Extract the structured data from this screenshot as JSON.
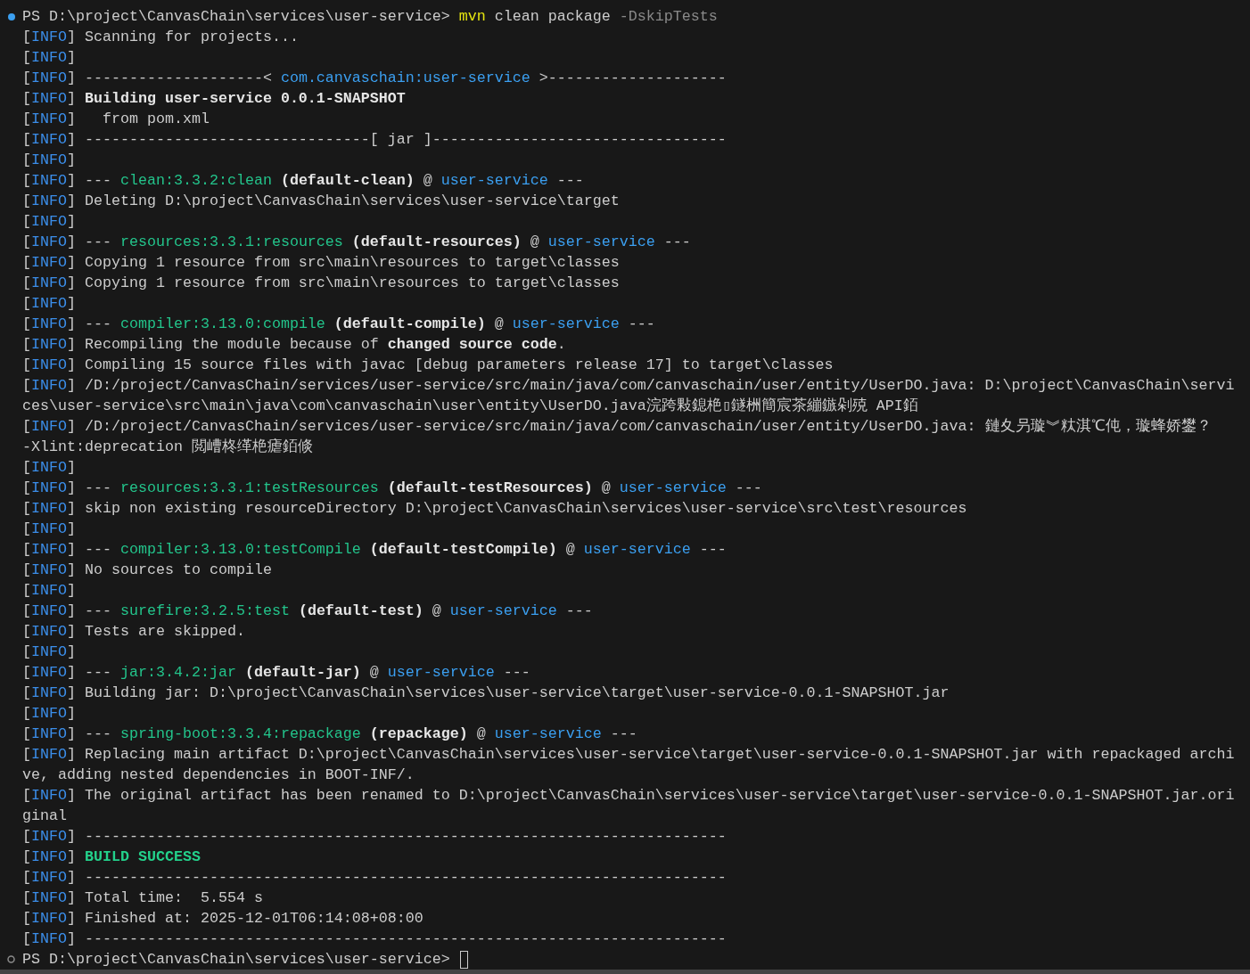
{
  "terminal": {
    "lines": [
      {
        "kind": "prompt",
        "completed": true,
        "segments": [
          {
            "kind": "plain",
            "text": "PS D:\\project\\CanvasChain\\services\\user-service> "
          },
          {
            "kind": "command",
            "text": "mvn"
          },
          {
            "kind": "plain",
            "text": " clean package "
          },
          {
            "kind": "dim",
            "text": "-DskipTests"
          }
        ]
      },
      {
        "kind": "info",
        "tag": "[INFO]",
        "segments": [
          {
            "kind": "plain",
            "text": "Scanning for projects..."
          }
        ]
      },
      {
        "kind": "info",
        "tag": "[INFO]"
      },
      {
        "kind": "info",
        "tag": "[INFO]",
        "segments": [
          {
            "kind": "plain",
            "text": "--------------------< "
          },
          {
            "kind": "project",
            "text": "com.canvaschain:user-service"
          },
          {
            "kind": "plain",
            "text": " >--------------------"
          }
        ]
      },
      {
        "kind": "info",
        "tag": "[INFO]",
        "segments": [
          {
            "kind": "bold",
            "text": "Building user-service 0.0.1-SNAPSHOT"
          }
        ]
      },
      {
        "kind": "info",
        "tag": "[INFO]",
        "segments": [
          {
            "kind": "plain",
            "text": "  from pom.xml"
          }
        ]
      },
      {
        "kind": "info",
        "tag": "[INFO]",
        "segments": [
          {
            "kind": "plain",
            "text": "--------------------------------[ jar ]---------------------------------"
          }
        ]
      },
      {
        "kind": "info",
        "tag": "[INFO]"
      },
      {
        "kind": "info",
        "tag": "[INFO]",
        "segments": [
          {
            "kind": "plain",
            "text": "--- "
          },
          {
            "kind": "plugin",
            "text": "clean:3.3.2:clean"
          },
          {
            "kind": "bold",
            "text": " (default-clean)"
          },
          {
            "kind": "plain",
            "text": " @ "
          },
          {
            "kind": "project",
            "text": "user-service"
          },
          {
            "kind": "plain",
            "text": " ---"
          }
        ]
      },
      {
        "kind": "info",
        "tag": "[INFO]",
        "segments": [
          {
            "kind": "plain",
            "text": "Deleting D:\\project\\CanvasChain\\services\\user-service\\target"
          }
        ]
      },
      {
        "kind": "info",
        "tag": "[INFO]"
      },
      {
        "kind": "info",
        "tag": "[INFO]",
        "segments": [
          {
            "kind": "plain",
            "text": "--- "
          },
          {
            "kind": "plugin",
            "text": "resources:3.3.1:resources"
          },
          {
            "kind": "bold",
            "text": " (default-resources)"
          },
          {
            "kind": "plain",
            "text": " @ "
          },
          {
            "kind": "project",
            "text": "user-service"
          },
          {
            "kind": "plain",
            "text": " ---"
          }
        ]
      },
      {
        "kind": "info",
        "tag": "[INFO]",
        "segments": [
          {
            "kind": "plain",
            "text": "Copying 1 resource from src\\main\\resources to target\\classes"
          }
        ]
      },
      {
        "kind": "info",
        "tag": "[INFO]",
        "segments": [
          {
            "kind": "plain",
            "text": "Copying 1 resource from src\\main\\resources to target\\classes"
          }
        ]
      },
      {
        "kind": "info",
        "tag": "[INFO]"
      },
      {
        "kind": "info",
        "tag": "[INFO]",
        "segments": [
          {
            "kind": "plain",
            "text": "--- "
          },
          {
            "kind": "plugin",
            "text": "compiler:3.13.0:compile"
          },
          {
            "kind": "bold",
            "text": " (default-compile)"
          },
          {
            "kind": "plain",
            "text": " @ "
          },
          {
            "kind": "project",
            "text": "user-service"
          },
          {
            "kind": "plain",
            "text": " ---"
          }
        ]
      },
      {
        "kind": "info",
        "tag": "[INFO]",
        "segments": [
          {
            "kind": "plain",
            "text": "Recompiling the module because of "
          },
          {
            "kind": "bold",
            "text": "changed source code"
          },
          {
            "kind": "plain",
            "text": "."
          }
        ]
      },
      {
        "kind": "info",
        "tag": "[INFO]",
        "segments": [
          {
            "kind": "plain",
            "text": "Compiling 15 source files with javac [debug parameters release 17] to target\\classes"
          }
        ]
      },
      {
        "kind": "info",
        "tag": "[INFO]",
        "segments": [
          {
            "kind": "plain",
            "text": "/D:/project/CanvasChain/services/user-service/src/main/java/com/canvaschain/user/entity/UserDO.java: D:\\project\\CanvasChain\\servi"
          }
        ]
      },
      {
        "kind": "continuation",
        "segments": [
          {
            "kind": "plain",
            "text": "ces\\user-service\\src\\main\\java\\com\\canvaschain\\user\\entity\\UserDO.java浣跨敤鎴栬▯鐩栦簡宸茶繃鏃剁殑 API銆"
          }
        ]
      },
      {
        "kind": "info",
        "tag": "[INFO]",
        "segments": [
          {
            "kind": "plain",
            "text": "/D:/project/CanvasChain/services/user-service/src/main/java/com/canvaschain/user/entity/UserDO.java: 鏈夊叧璇︾粏淇℃伅，璇蜂娇鐢？"
          }
        ]
      },
      {
        "kind": "continuation",
        "segments": [
          {
            "kind": "plain",
            "text": "-Xlint:deprecation 閲嶆柊缂栬瘧銆倐"
          }
        ]
      },
      {
        "kind": "info",
        "tag": "[INFO]"
      },
      {
        "kind": "info",
        "tag": "[INFO]",
        "segments": [
          {
            "kind": "plain",
            "text": "--- "
          },
          {
            "kind": "plugin",
            "text": "resources:3.3.1:testResources"
          },
          {
            "kind": "bold",
            "text": " (default-testResources)"
          },
          {
            "kind": "plain",
            "text": " @ "
          },
          {
            "kind": "project",
            "text": "user-service"
          },
          {
            "kind": "plain",
            "text": " ---"
          }
        ]
      },
      {
        "kind": "info",
        "tag": "[INFO]",
        "segments": [
          {
            "kind": "plain",
            "text": "skip non existing resourceDirectory D:\\project\\CanvasChain\\services\\user-service\\src\\test\\resources"
          }
        ]
      },
      {
        "kind": "info",
        "tag": "[INFO]"
      },
      {
        "kind": "info",
        "tag": "[INFO]",
        "segments": [
          {
            "kind": "plain",
            "text": "--- "
          },
          {
            "kind": "plugin",
            "text": "compiler:3.13.0:testCompile"
          },
          {
            "kind": "bold",
            "text": " (default-testCompile)"
          },
          {
            "kind": "plain",
            "text": " @ "
          },
          {
            "kind": "project",
            "text": "user-service"
          },
          {
            "kind": "plain",
            "text": " ---"
          }
        ]
      },
      {
        "kind": "info",
        "tag": "[INFO]",
        "segments": [
          {
            "kind": "plain",
            "text": "No sources to compile"
          }
        ]
      },
      {
        "kind": "info",
        "tag": "[INFO]"
      },
      {
        "kind": "info",
        "tag": "[INFO]",
        "segments": [
          {
            "kind": "plain",
            "text": "--- "
          },
          {
            "kind": "plugin",
            "text": "surefire:3.2.5:test"
          },
          {
            "kind": "bold",
            "text": " (default-test)"
          },
          {
            "kind": "plain",
            "text": " @ "
          },
          {
            "kind": "project",
            "text": "user-service"
          },
          {
            "kind": "plain",
            "text": " ---"
          }
        ]
      },
      {
        "kind": "info",
        "tag": "[INFO]",
        "segments": [
          {
            "kind": "plain",
            "text": "Tests are skipped."
          }
        ]
      },
      {
        "kind": "info",
        "tag": "[INFO]"
      },
      {
        "kind": "info",
        "tag": "[INFO]",
        "segments": [
          {
            "kind": "plain",
            "text": "--- "
          },
          {
            "kind": "plugin",
            "text": "jar:3.4.2:jar"
          },
          {
            "kind": "bold",
            "text": " (default-jar)"
          },
          {
            "kind": "plain",
            "text": " @ "
          },
          {
            "kind": "project",
            "text": "user-service"
          },
          {
            "kind": "plain",
            "text": " ---"
          }
        ]
      },
      {
        "kind": "info",
        "tag": "[INFO]",
        "segments": [
          {
            "kind": "plain",
            "text": "Building jar: D:\\project\\CanvasChain\\services\\user-service\\target\\user-service-0.0.1-SNAPSHOT.jar"
          }
        ]
      },
      {
        "kind": "info",
        "tag": "[INFO]"
      },
      {
        "kind": "info",
        "tag": "[INFO]",
        "segments": [
          {
            "kind": "plain",
            "text": "--- "
          },
          {
            "kind": "plugin",
            "text": "spring-boot:3.3.4:repackage"
          },
          {
            "kind": "bold",
            "text": " (repackage)"
          },
          {
            "kind": "plain",
            "text": " @ "
          },
          {
            "kind": "project",
            "text": "user-service"
          },
          {
            "kind": "plain",
            "text": " ---"
          }
        ]
      },
      {
        "kind": "info",
        "tag": "[INFO]",
        "segments": [
          {
            "kind": "plain",
            "text": "Replacing main artifact D:\\project\\CanvasChain\\services\\user-service\\target\\user-service-0.0.1-SNAPSHOT.jar with repackaged archi"
          }
        ]
      },
      {
        "kind": "continuation",
        "segments": [
          {
            "kind": "plain",
            "text": "ve, adding nested dependencies in BOOT-INF/."
          }
        ]
      },
      {
        "kind": "info",
        "tag": "[INFO]",
        "segments": [
          {
            "kind": "plain",
            "text": "The original artifact has been renamed to D:\\project\\CanvasChain\\services\\user-service\\target\\user-service-0.0.1-SNAPSHOT.jar.ori"
          }
        ]
      },
      {
        "kind": "continuation",
        "segments": [
          {
            "kind": "plain",
            "text": "ginal"
          }
        ]
      },
      {
        "kind": "info",
        "tag": "[INFO]",
        "segments": [
          {
            "kind": "plain",
            "text": "------------------------------------------------------------------------"
          }
        ]
      },
      {
        "kind": "info",
        "tag": "[INFO]",
        "segments": [
          {
            "kind": "success",
            "text": "BUILD SUCCESS"
          }
        ]
      },
      {
        "kind": "info",
        "tag": "[INFO]",
        "segments": [
          {
            "kind": "plain",
            "text": "------------------------------------------------------------------------"
          }
        ]
      },
      {
        "kind": "info",
        "tag": "[INFO]",
        "segments": [
          {
            "kind": "plain",
            "text": "Total time:  5.554 s"
          }
        ]
      },
      {
        "kind": "info",
        "tag": "[INFO]",
        "segments": [
          {
            "kind": "plain",
            "text": "Finished at: 2025-12-01T06:14:08+08:00"
          }
        ]
      },
      {
        "kind": "info",
        "tag": "[INFO]",
        "segments": [
          {
            "kind": "plain",
            "text": "------------------------------------------------------------------------"
          }
        ]
      },
      {
        "kind": "prompt",
        "completed": false,
        "cursor": true,
        "segments": [
          {
            "kind": "plain",
            "text": "PS D:\\project\\CanvasChain\\services\\user-service> "
          }
        ]
      }
    ]
  }
}
